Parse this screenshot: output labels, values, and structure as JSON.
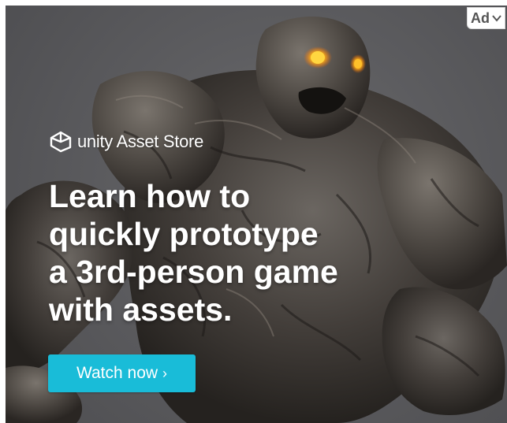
{
  "brand": {
    "logo_icon": "unity-cube-icon",
    "name": "unity",
    "product": "Asset Store"
  },
  "headline": {
    "lines": [
      "Learn how to",
      "quickly prototype",
      "a 3rd-person game",
      "with assets."
    ]
  },
  "cta": {
    "label": "Watch now",
    "chevron": "›"
  },
  "ad_badge": {
    "label": "Ad",
    "icon": "chevron-down-icon"
  },
  "colors": {
    "background": "#5e5e61",
    "cta_background": "#19bcd8",
    "text": "#ffffff",
    "monster_eyes": "#ffb31a"
  }
}
